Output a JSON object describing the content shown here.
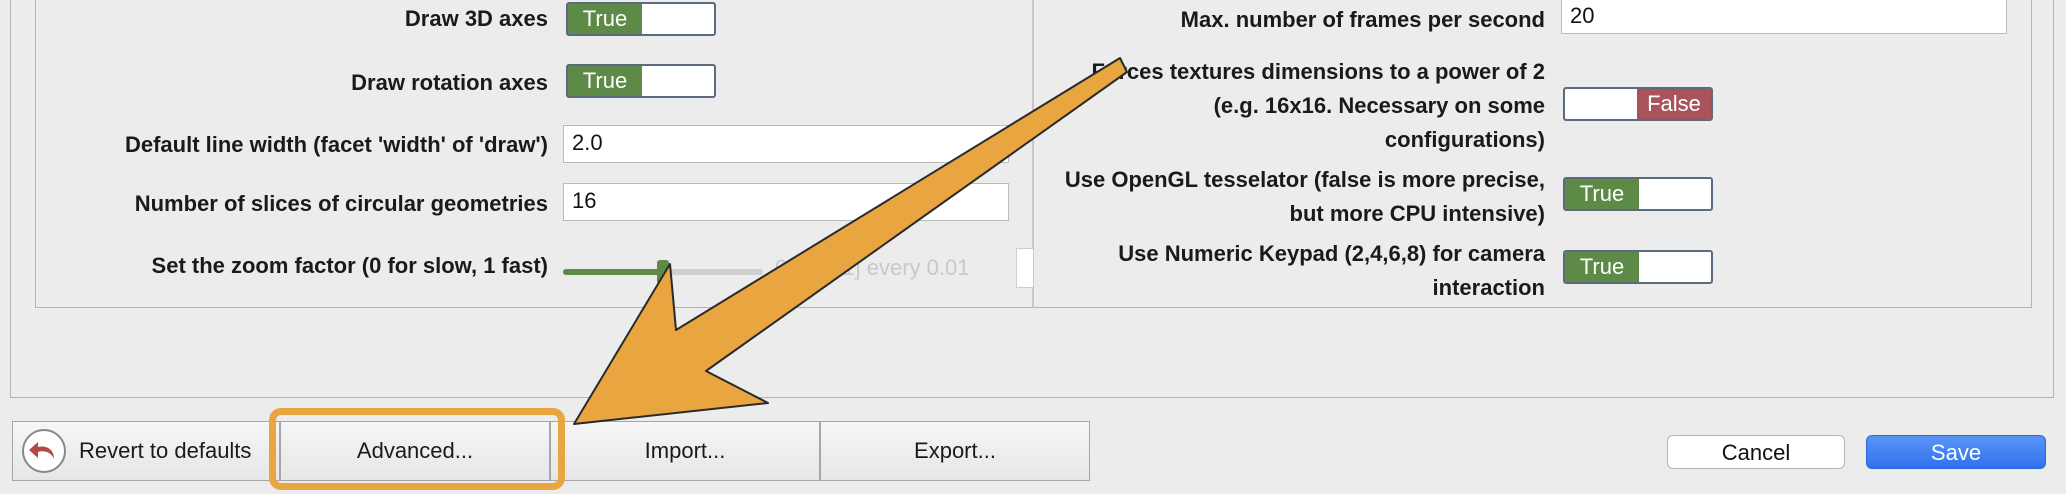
{
  "left_settings": {
    "draw_3d_axes": {
      "label": "Draw 3D axes",
      "value": "True"
    },
    "draw_rotation_axes": {
      "label": "Draw rotation axes",
      "value": "True"
    },
    "default_line_width": {
      "label": "Default line width (facet 'width' of 'draw')",
      "value": "2.0"
    },
    "num_slices": {
      "label": "Number of slices of circular geometries",
      "value": "16"
    },
    "zoom_factor": {
      "label": "Set the zoom factor (0 for slow, 1 fast)",
      "range_text": "0 .. [0..1] every 0.01",
      "level": 0.5
    }
  },
  "right_settings": {
    "max_fps": {
      "label": "Max. number of frames per second",
      "value": "20"
    },
    "power_of_two": {
      "label_line1": "Forces textures dimensions to a power of 2",
      "label_line2": "(e.g. 16x16. Necessary on some",
      "label_line3": "configurations)",
      "value": "False"
    },
    "opengl_tesselator": {
      "label_line1": "Use OpenGL tesselator (false is more precise,",
      "label_line2": "but more CPU intensive)",
      "value": "True"
    },
    "numeric_keypad": {
      "label_line1": "Use Numeric Keypad (2,4,6,8) for camera",
      "label_line2": "interaction",
      "value": "True"
    }
  },
  "bottom_bar": {
    "revert_label": "Revert to defaults",
    "advanced_label": "Advanced...",
    "import_label": "Import...",
    "export_label": "Export...",
    "cancel_label": "Cancel",
    "save_label": "Save"
  },
  "annotation": {
    "arrow_color": "#e9a540",
    "highlight_target": "Advanced..."
  },
  "colors": {
    "true_green": "#5d8a47",
    "false_red": "#a9545a",
    "save_blue": "#3d7ff2"
  }
}
